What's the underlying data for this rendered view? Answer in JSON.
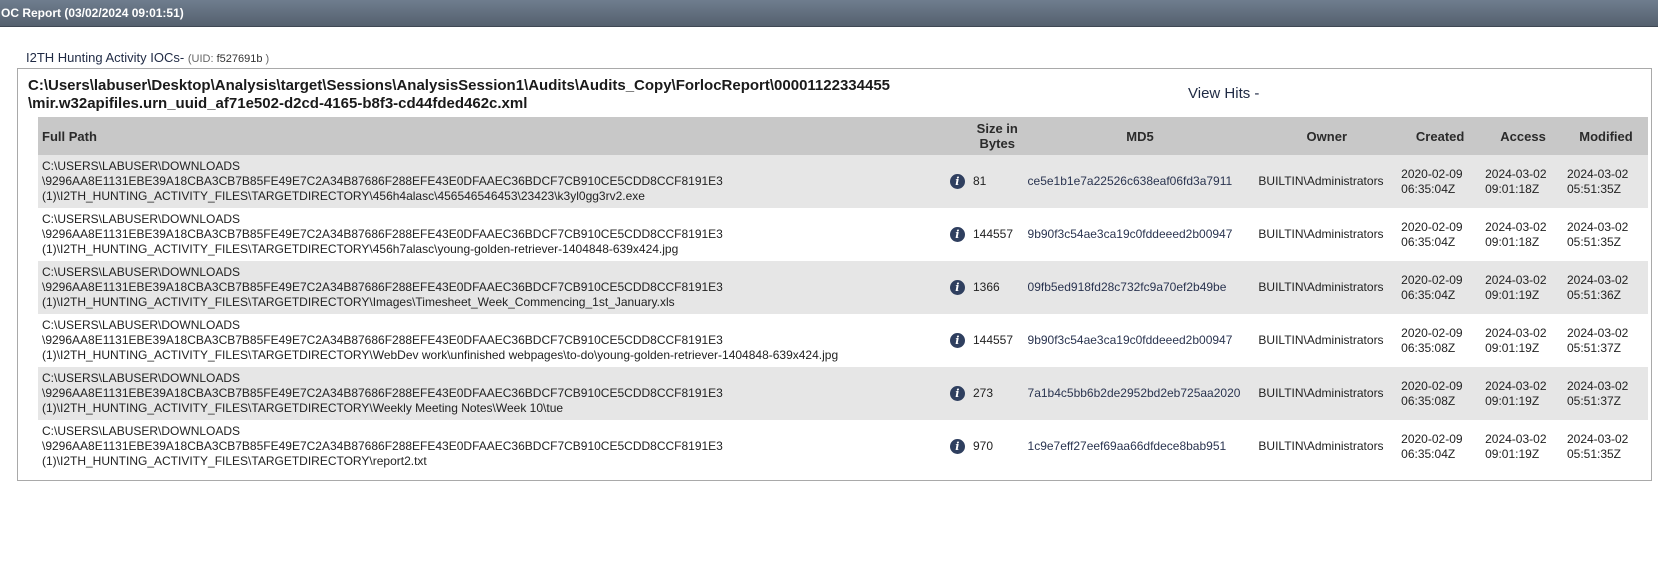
{
  "window": {
    "title": "OC Report (03/02/2024 09:01:51)"
  },
  "ioc": {
    "name": "I2TH Hunting Activity IOCs-",
    "uid_label": "(UID:",
    "uid_value": "f527691b",
    "uid_close": ")"
  },
  "report": {
    "path_line1": "C:\\Users\\labuser\\Desktop\\Analysis\\target\\Sessions\\AnalysisSession1\\Audits\\Audits_Copy\\ForlocReport\\00001122334455",
    "path_line2": "\\mir.w32apifiles.urn_uuid_af71e502-d2cd-4165-b8f3-cd44fded462c.xml",
    "view_hits": "View Hits -"
  },
  "table": {
    "headers": {
      "full_path": "Full Path",
      "size_line1": "Size in",
      "size_line2": "Bytes",
      "md5": "MD5",
      "owner": "Owner",
      "created": "Created",
      "access": "Access",
      "modified": "Modified"
    },
    "rows": [
      {
        "path1": "C:\\USERS\\LABUSER\\DOWNLOADS",
        "path2": "\\9296AA8E1131EBE39A18CBA3CB7B85FE49E7C2A34B87686F288EFE43E0DFAAEC36BDCF7CB910CE5CDD8CCF8191E3",
        "path3": "(1)\\I2TH_HUNTING_ACTIVITY_FILES\\TARGETDIRECTORY\\456h4alasc\\456546546453\\23423\\k3yl0gg3rv2.exe",
        "size": "81",
        "md5": "ce5e1b1e7a22526c638eaf06fd3a7911",
        "owner": "BUILTIN\\Administrators",
        "created_date": "2020-02-09",
        "created_time": "06:35:04Z",
        "access_date": "2024-03-02",
        "access_time": "09:01:18Z",
        "modified_date": "2024-03-02",
        "modified_time": "05:51:35Z"
      },
      {
        "path1": "C:\\USERS\\LABUSER\\DOWNLOADS",
        "path2": "\\9296AA8E1131EBE39A18CBA3CB7B85FE49E7C2A34B87686F288EFE43E0DFAAEC36BDCF7CB910CE5CDD8CCF8191E3",
        "path3": "(1)\\I2TH_HUNTING_ACTIVITY_FILES\\TARGETDIRECTORY\\456h7alasc\\young-golden-retriever-1404848-639x424.jpg",
        "size": "144557",
        "md5": "9b90f3c54ae3ca19c0fddeeed2b00947",
        "owner": "BUILTIN\\Administrators",
        "created_date": "2020-02-09",
        "created_time": "06:35:04Z",
        "access_date": "2024-03-02",
        "access_time": "09:01:18Z",
        "modified_date": "2024-03-02",
        "modified_time": "05:51:35Z"
      },
      {
        "path1": "C:\\USERS\\LABUSER\\DOWNLOADS",
        "path2": "\\9296AA8E1131EBE39A18CBA3CB7B85FE49E7C2A34B87686F288EFE43E0DFAAEC36BDCF7CB910CE5CDD8CCF8191E3",
        "path3": "(1)\\I2TH_HUNTING_ACTIVITY_FILES\\TARGETDIRECTORY\\Images\\Timesheet_Week_Commencing_1st_January.xls",
        "size": "1366",
        "md5": "09fb5ed918fd28c732fc9a70ef2b49be",
        "owner": "BUILTIN\\Administrators",
        "created_date": "2020-02-09",
        "created_time": "06:35:04Z",
        "access_date": "2024-03-02",
        "access_time": "09:01:19Z",
        "modified_date": "2024-03-02",
        "modified_time": "05:51:36Z"
      },
      {
        "path1": "C:\\USERS\\LABUSER\\DOWNLOADS",
        "path2": "\\9296AA8E1131EBE39A18CBA3CB7B85FE49E7C2A34B87686F288EFE43E0DFAAEC36BDCF7CB910CE5CDD8CCF8191E3",
        "path3": "(1)\\I2TH_HUNTING_ACTIVITY_FILES\\TARGETDIRECTORY\\WebDev work\\unfinished webpages\\to-do\\young-golden-retriever-1404848-639x424.jpg",
        "size": "144557",
        "md5": "9b90f3c54ae3ca19c0fddeeed2b00947",
        "owner": "BUILTIN\\Administrators",
        "created_date": "2020-02-09",
        "created_time": "06:35:08Z",
        "access_date": "2024-03-02",
        "access_time": "09:01:19Z",
        "modified_date": "2024-03-02",
        "modified_time": "05:51:37Z"
      },
      {
        "path1": "C:\\USERS\\LABUSER\\DOWNLOADS",
        "path2": "\\9296AA8E1131EBE39A18CBA3CB7B85FE49E7C2A34B87686F288EFE43E0DFAAEC36BDCF7CB910CE5CDD8CCF8191E3",
        "path3": "(1)\\I2TH_HUNTING_ACTIVITY_FILES\\TARGETDIRECTORY\\Weekly Meeting Notes\\Week 10\\tue",
        "size": "273",
        "md5": "7a1b4c5bb6b2de2952bd2eb725aa2020",
        "owner": "BUILTIN\\Administrators",
        "created_date": "2020-02-09",
        "created_time": "06:35:08Z",
        "access_date": "2024-03-02",
        "access_time": "09:01:19Z",
        "modified_date": "2024-03-02",
        "modified_time": "05:51:37Z"
      },
      {
        "path1": "C:\\USERS\\LABUSER\\DOWNLOADS",
        "path2": "\\9296AA8E1131EBE39A18CBA3CB7B85FE49E7C2A34B87686F288EFE43E0DFAAEC36BDCF7CB910CE5CDD8CCF8191E3",
        "path3": "(1)\\I2TH_HUNTING_ACTIVITY_FILES\\TARGETDIRECTORY\\report2.txt",
        "size": "970",
        "md5": "1c9e7eff27eef69aa66dfdece8bab951",
        "owner": "BUILTIN\\Administrators",
        "created_date": "2020-02-09",
        "created_time": "06:35:04Z",
        "access_date": "2024-03-02",
        "access_time": "09:01:19Z",
        "modified_date": "2024-03-02",
        "modified_time": "05:51:35Z"
      }
    ]
  },
  "icons": {
    "row_info": "info-icon"
  },
  "colors": {
    "title_bar": "#5f6b7b",
    "header_bg": "#c8c8c8",
    "row_alt": "#e6e6e6",
    "info_icon": "#2f3f5f"
  }
}
